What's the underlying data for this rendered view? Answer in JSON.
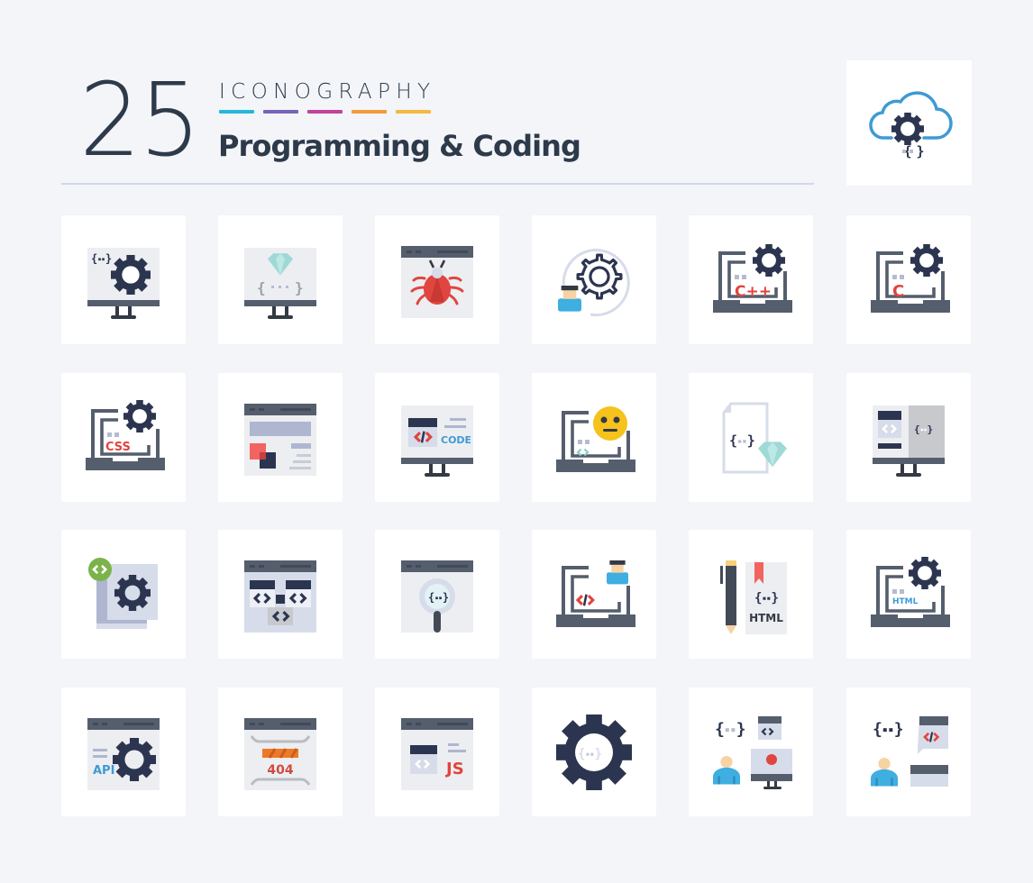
{
  "header": {
    "count": "25",
    "kicker": "ICONOGRAPHY",
    "title": "Programming & Coding",
    "accent_bars": [
      "#27b8d9",
      "#7962b8",
      "#c3429a",
      "#f29b3c",
      "#f3b940"
    ]
  },
  "featured_icon": {
    "name": "cloud-gear-code-icon",
    "label": "Cloud settings with code"
  },
  "palette": {
    "background": "#f3f5f9",
    "card": "#ffffff",
    "dark": "#2c3550",
    "slate": "#555e6d",
    "light_panel": "#eceef1",
    "lavender": "#d7dcea",
    "red": "#e0453f",
    "blue": "#3e9ad4",
    "teal": "#9fd9d6",
    "yellow": "#f6c21c",
    "green": "#7bb34a",
    "orange": "#ec7a26"
  },
  "icons": [
    {
      "id": "monitor-gear-code",
      "label": "Monitor with gear and code brackets"
    },
    {
      "id": "monitor-diamond-code",
      "label": "Monitor with diamond and code"
    },
    {
      "id": "browser-bug",
      "label": "Browser window with bug"
    },
    {
      "id": "person-gear",
      "label": "Developer with gear"
    },
    {
      "id": "laptop-cpp-gear",
      "label": "Laptop with C++ and gear",
      "text": "C++"
    },
    {
      "id": "laptop-c-gear",
      "label": "Laptop with C and gear",
      "text": "C"
    },
    {
      "id": "laptop-css-gear",
      "label": "Laptop with CSS and gear",
      "text": "CSS"
    },
    {
      "id": "browser-layout",
      "label": "Browser page layout"
    },
    {
      "id": "monitor-code",
      "label": "Monitor showing code",
      "text": "CODE"
    },
    {
      "id": "laptop-emoji",
      "label": "Laptop with neutral emoji"
    },
    {
      "id": "file-diamond-code",
      "label": "File with code and diamond"
    },
    {
      "id": "monitor-split-code",
      "label": "Monitor split code panels"
    },
    {
      "id": "pages-gear-badge",
      "label": "Pages with gear and code badge"
    },
    {
      "id": "browser-code-blocks",
      "label": "Browser with code blocks"
    },
    {
      "id": "browser-search-code",
      "label": "Browser with magnifier and code"
    },
    {
      "id": "laptop-developer",
      "label": "Laptop with developer"
    },
    {
      "id": "pen-html-book",
      "label": "Pen and HTML book",
      "text": "HTML"
    },
    {
      "id": "laptop-html-gear",
      "label": "Laptop with HTML and gear",
      "text": "HTML"
    },
    {
      "id": "browser-api-gear",
      "label": "Browser with API gear",
      "text": "API"
    },
    {
      "id": "browser-404",
      "label": "Browser 404 error page",
      "text": "404"
    },
    {
      "id": "browser-js",
      "label": "Browser with JavaScript",
      "text": "JS"
    },
    {
      "id": "gear-code",
      "label": "Gear with code"
    },
    {
      "id": "person-monitor-record",
      "label": "Person with monitor and code"
    },
    {
      "id": "person-chat-code",
      "label": "Person with code chat"
    }
  ]
}
